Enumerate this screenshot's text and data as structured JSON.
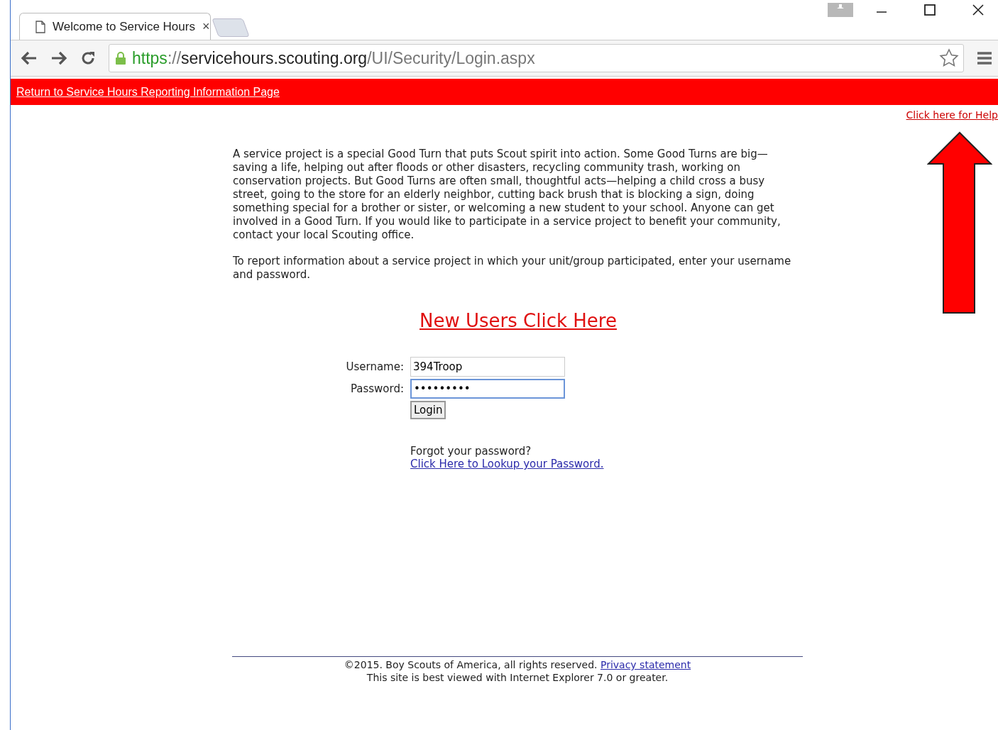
{
  "browser": {
    "tab": {
      "title": "Welcome to Service Hours",
      "close": "×"
    },
    "url": [
      {
        "text": "https",
        "kind": "scheme"
      },
      {
        "text": "://",
        "kind": "sep"
      },
      {
        "text": "servicehours.scouting.org",
        "kind": "host"
      },
      {
        "text": "/UI/Security/Login.aspx",
        "kind": "path"
      }
    ]
  },
  "top_bar": {
    "link": "Return to Service Hours Reporting Information Page"
  },
  "help_link": "Click here for Help",
  "intro_paragraphs": [
    "A service project is a special Good Turn that puts Scout spirit into action. Some Good Turns are big—saving a life, helping out after floods or other disasters, recycling community trash, working on conservation projects. But Good Turns are often small, thoughtful acts—helping a child cross a busy street, going to the store for an elderly neighbor, cutting back brush that is blocking a sign, doing something special for a brother or sister, or welcoming a new student to your school. Anyone can get involved in a Good Turn. If you would like to participate in a service project to benefit your community, contact your local Scouting office.",
    "To report information about a service project in which your unit/group participated, enter your username and password."
  ],
  "new_users_link": "New Users Click Here",
  "login_form": {
    "fields": [
      {
        "label": "Username:",
        "value": "394Troop",
        "focused": false
      },
      {
        "label": "Password:",
        "value": "•••••••••",
        "focused": true
      }
    ],
    "button": "Login"
  },
  "forgot": {
    "question": "Forgot your password?",
    "link": "Click Here to Lookup your Password."
  },
  "footer": {
    "copyright": "©2015. Boy Scouts of America, all rights reserved.",
    "privacy_link": "Privacy statement",
    "note": "This site is best viewed with Internet Explorer 7.0 or greater."
  }
}
